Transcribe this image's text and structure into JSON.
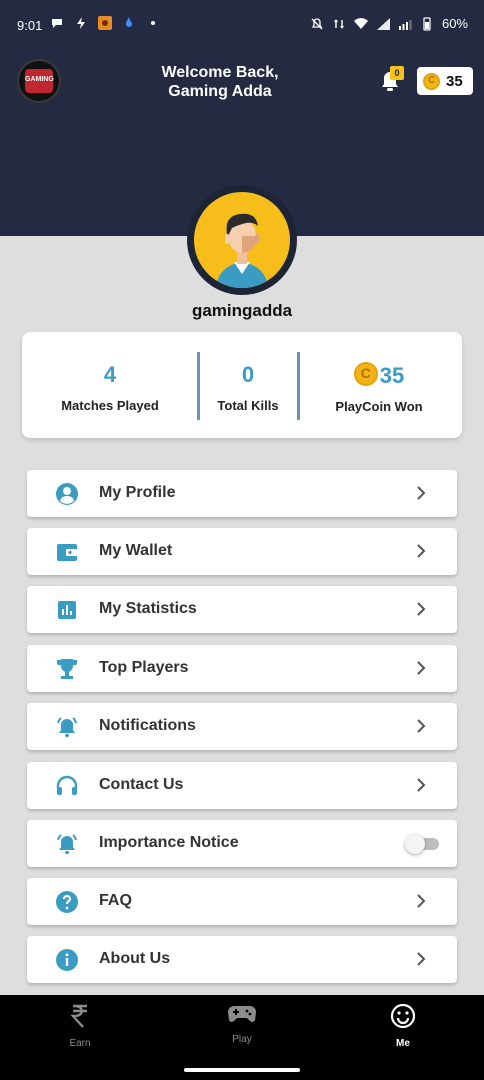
{
  "status_bar": {
    "time": "9:01",
    "battery": "60%"
  },
  "header": {
    "logo_text": "GAMING",
    "welcome_line1": "Welcome Back,",
    "welcome_line2": "Gaming Adda",
    "notification_count": "0",
    "coin_balance": "35"
  },
  "profile": {
    "username": "gamingadda"
  },
  "stats": [
    {
      "value": "4",
      "label": "Matches Played"
    },
    {
      "value": "0",
      "label": "Total Kills"
    },
    {
      "value": "35",
      "label": "PlayCoin Won"
    }
  ],
  "menu": [
    {
      "label": "My Profile",
      "icon": "account-circle-icon"
    },
    {
      "label": "My Wallet",
      "icon": "wallet-icon"
    },
    {
      "label": "My Statistics",
      "icon": "bar-chart-icon"
    },
    {
      "label": "Top Players",
      "icon": "trophy-icon"
    },
    {
      "label": "Notifications",
      "icon": "bell-ring-icon"
    },
    {
      "label": "Contact Us",
      "icon": "headset-icon"
    },
    {
      "label": "Importance Notice",
      "icon": "bell-ring-icon",
      "toggle": false
    },
    {
      "label": "FAQ",
      "icon": "help-circle-icon"
    },
    {
      "label": "About Us",
      "icon": "info-icon"
    }
  ],
  "bottom_nav": [
    {
      "label": "Earn",
      "icon": "rupee-icon"
    },
    {
      "label": "Play",
      "icon": "gamepad-icon"
    },
    {
      "label": "Me",
      "icon": "smiley-icon",
      "active": true
    }
  ],
  "colors": {
    "header_bg": "#242a42",
    "accent": "#3a9cc3",
    "coin": "#f3b617",
    "page_bg": "#dedede"
  }
}
